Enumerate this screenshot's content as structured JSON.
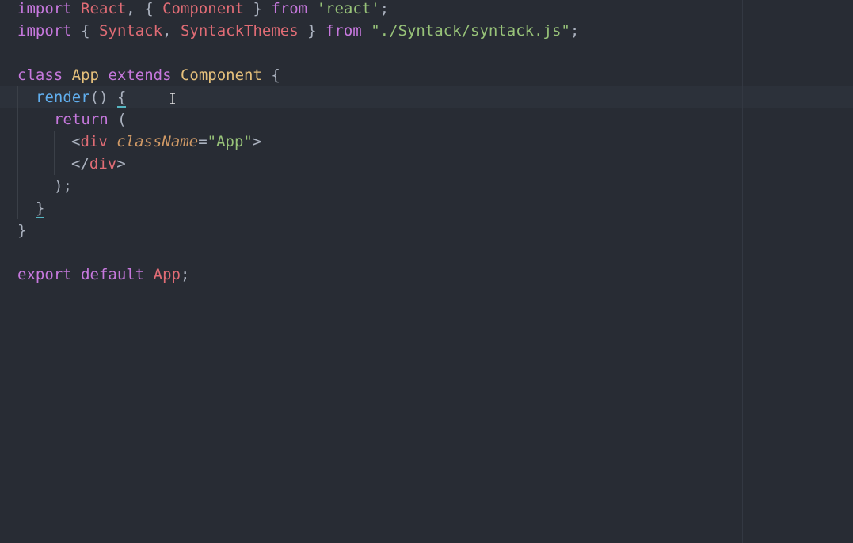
{
  "editor": {
    "language": "javascript",
    "theme_colors": {
      "background": "#282c34",
      "keyword": "#c678dd",
      "identifier": "#e06c75",
      "class_name": "#e5c07b",
      "string": "#98c379",
      "function": "#61afef",
      "punctuation": "#abb2bf",
      "attribute": "#d19a66",
      "bracket_match": "#56b6c2"
    },
    "lines": {
      "l1": {
        "import": "import",
        "react": "React",
        "comma": ", ",
        "brace_open": "{ ",
        "component": "Component",
        "brace_close": " } ",
        "from": "from",
        "module": "'react'",
        "semi": ";"
      },
      "l2": {
        "import": "import",
        "brace_open": " { ",
        "syntack": "Syntack",
        "comma": ", ",
        "themes": "SyntackThemes",
        "brace_close": " } ",
        "from": "from",
        "module": "\"./Syntack/syntack.js\"",
        "semi": ";"
      },
      "l4": {
        "class": "class",
        "name": "App",
        "extends": "extends",
        "parent": "Component",
        "brace": " {"
      },
      "l5": {
        "method": "render",
        "parens": "() ",
        "brace": "{"
      },
      "l6": {
        "return": "return",
        "paren": " ("
      },
      "l7": {
        "lt": "<",
        "tag": "div",
        "attr": "className",
        "eq": "=",
        "value": "\"App\"",
        "gt": ">"
      },
      "l8": {
        "lt": "</",
        "tag": "div",
        "gt": ">"
      },
      "l9": {
        "close": ");"
      },
      "l10": {
        "brace": "}"
      },
      "l11": {
        "brace": "}"
      },
      "l13": {
        "export": "export",
        "default": "default",
        "name": "App",
        "semi": ";"
      }
    }
  }
}
